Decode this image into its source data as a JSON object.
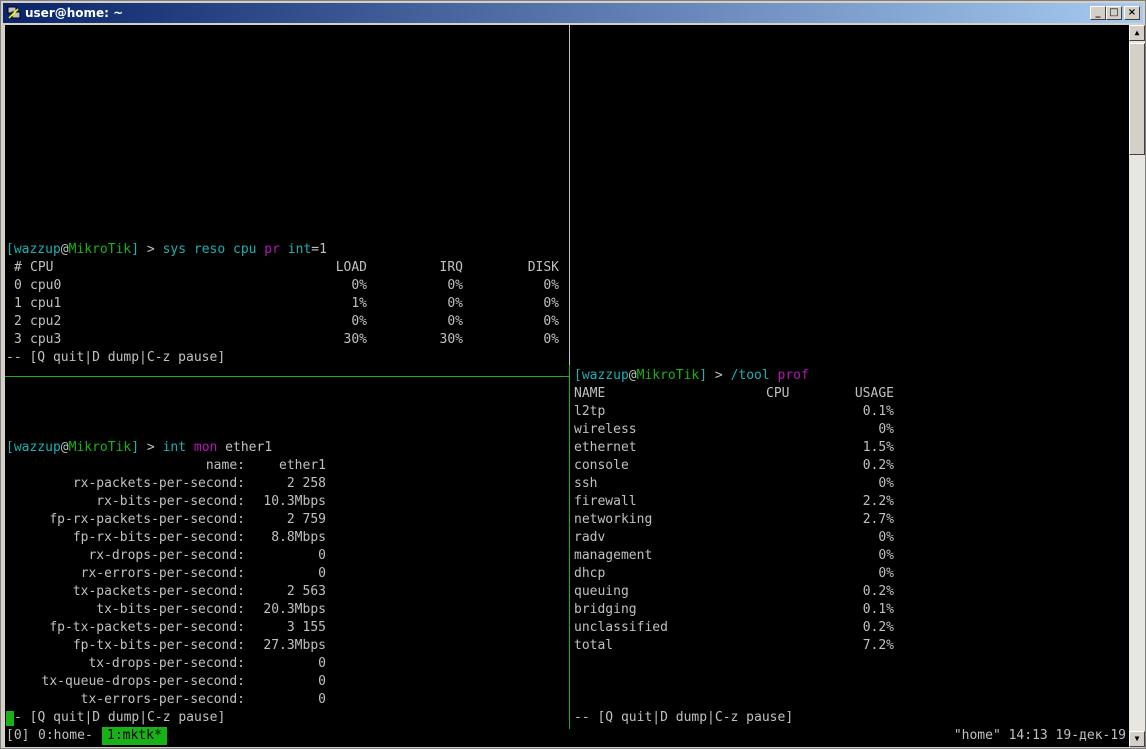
{
  "window": {
    "title": "user@home: ~",
    "buttons": {
      "minimize": "_",
      "maximize": "□",
      "close": "×"
    }
  },
  "pane_cpu": {
    "prompt": {
      "open": "[",
      "user": "wazzup",
      "at": "@",
      "host": "MikroTik",
      "close": "]",
      "arrow": " > "
    },
    "cmd": [
      {
        "text": "sys reso cpu",
        "color": "cyan"
      },
      {
        "text": " pr",
        "color": "magenta"
      },
      {
        "text": " int",
        "color": "cyan"
      },
      {
        "text": "=1",
        "color": "gray"
      }
    ],
    "headers": {
      "idx": "#",
      "cpu": "CPU",
      "load": "LOAD",
      "irq": "IRQ",
      "disk": "DISK"
    },
    "rows": [
      {
        "idx": "0",
        "cpu": "cpu0",
        "load": "0%",
        "irq": "0%",
        "disk": "0%"
      },
      {
        "idx": "1",
        "cpu": "cpu1",
        "load": "1%",
        "irq": "0%",
        "disk": "0%"
      },
      {
        "idx": "2",
        "cpu": "cpu2",
        "load": "0%",
        "irq": "0%",
        "disk": "0%"
      },
      {
        "idx": "3",
        "cpu": "cpu3",
        "load": "30%",
        "irq": "30%",
        "disk": "0%"
      }
    ],
    "footer": "-- [Q quit|D dump|C-z pause]"
  },
  "pane_int": {
    "cmd": [
      {
        "text": "int",
        "color": "cyan"
      },
      {
        "text": " mon",
        "color": "magenta"
      },
      {
        "text": " ether1",
        "color": "gray"
      }
    ],
    "rows": [
      {
        "label": "name:",
        "value": "ether1"
      },
      {
        "label": "rx-packets-per-second:",
        "value": "2 258"
      },
      {
        "label": "rx-bits-per-second:",
        "value": "10.3Mbps"
      },
      {
        "label": "fp-rx-packets-per-second:",
        "value": "2 759"
      },
      {
        "label": "fp-rx-bits-per-second:",
        "value": "8.8Mbps"
      },
      {
        "label": "rx-drops-per-second:",
        "value": "0"
      },
      {
        "label": "rx-errors-per-second:",
        "value": "0"
      },
      {
        "label": "tx-packets-per-second:",
        "value": "2 563"
      },
      {
        "label": "tx-bits-per-second:",
        "value": "20.3Mbps"
      },
      {
        "label": "fp-tx-packets-per-second:",
        "value": "3 155"
      },
      {
        "label": "fp-tx-bits-per-second:",
        "value": "27.3Mbps"
      },
      {
        "label": "tx-drops-per-second:",
        "value": "0"
      },
      {
        "label": "tx-queue-drops-per-second:",
        "value": "0"
      },
      {
        "label": "tx-errors-per-second:",
        "value": "0"
      }
    ],
    "footer": "- [Q quit|D dump|C-z pause]"
  },
  "pane_prof": {
    "cmd": [
      {
        "text": "/tool",
        "color": "cyan"
      },
      {
        "text": " prof",
        "color": "magenta"
      }
    ],
    "headers": {
      "name": "NAME",
      "cpu": "CPU",
      "usage": "USAGE"
    },
    "rows": [
      {
        "name": "l2tp",
        "usage": "0.1%"
      },
      {
        "name": "wireless",
        "usage": "0%"
      },
      {
        "name": "ethernet",
        "usage": "1.5%"
      },
      {
        "name": "console",
        "usage": "0.2%"
      },
      {
        "name": "ssh",
        "usage": "0%"
      },
      {
        "name": "firewall",
        "usage": "2.2%"
      },
      {
        "name": "networking",
        "usage": "2.7%"
      },
      {
        "name": "radv",
        "usage": "0%"
      },
      {
        "name": "management",
        "usage": "0%"
      },
      {
        "name": "dhcp",
        "usage": "0%"
      },
      {
        "name": "queuing",
        "usage": "0.2%"
      },
      {
        "name": "bridging",
        "usage": "0.1%"
      },
      {
        "name": "unclassified",
        "usage": "0.2%"
      },
      {
        "name": "total",
        "usage": "7.2%"
      }
    ],
    "footer": "-- [Q quit|D dump|C-z pause]"
  },
  "statusbar": {
    "session": "[0]",
    "win0": "0:home-",
    "win1": "1:mktk*",
    "right": "\"home\" 14:13 19-дек-19"
  },
  "colors": {
    "user": "#18b2b2",
    "host": "#18b218",
    "cyan": "#18b2b2",
    "magenta": "#b218b2",
    "gray": "#c0c0c0",
    "green": "#18b218"
  }
}
